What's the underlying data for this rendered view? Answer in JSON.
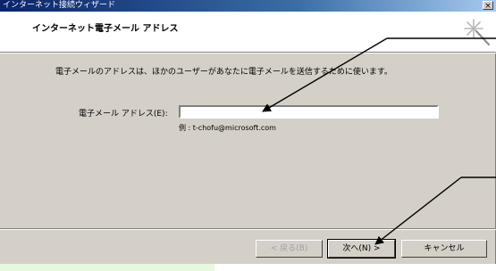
{
  "window": {
    "title": "インターネット接続ウィザード",
    "close_glyph": "×"
  },
  "header": {
    "title": "インターネット電子メール アドレス"
  },
  "body": {
    "description": "電子メールのアドレスは、ほかのユーザーがあなたに電子メールを送信するために使います。",
    "email_label": "電子メール アドレス(E):",
    "email_value": "",
    "email_example": "例 : t-chofu@microsoft.com"
  },
  "buttons": {
    "back": "< 戻る(B)",
    "next": "次へ(N) >",
    "cancel": "キャンセル"
  },
  "icons": {
    "header_icon": "wizard-wand-icon",
    "annotation": "annotation-arrow"
  },
  "colors": {
    "dialog_face": "#d4d0c8",
    "titlebar_start": "#0a246a",
    "side_panel": "#e6f8e0"
  }
}
